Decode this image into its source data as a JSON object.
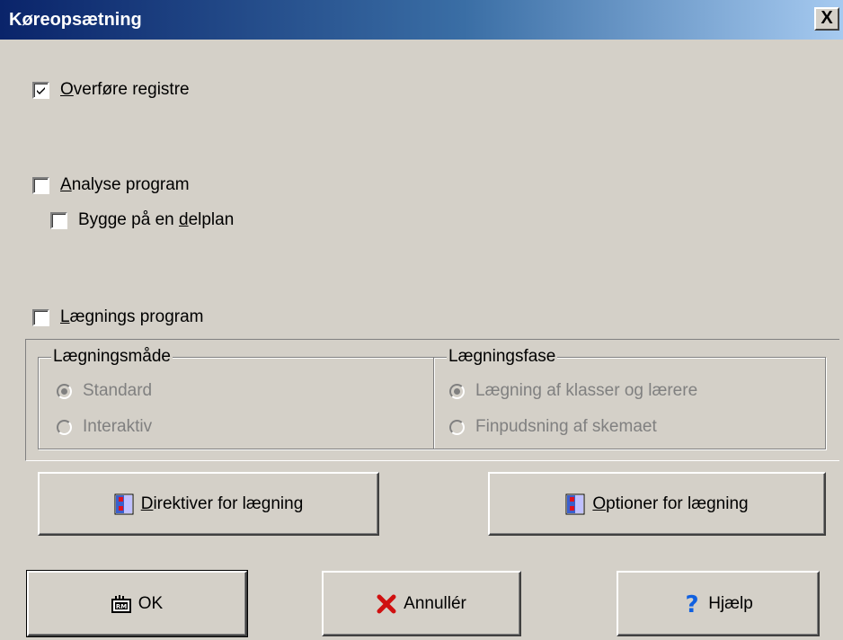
{
  "window": {
    "title": "Køreopsætning",
    "close_label": "X"
  },
  "checks": {
    "transfer": {
      "prefix": "",
      "accel": "O",
      "rest": "verføre registre",
      "checked": true
    },
    "analyse": {
      "prefix": "",
      "accel": "A",
      "rest": "nalyse program",
      "checked": false
    },
    "build": {
      "prefix": "Bygge på en ",
      "accel": "d",
      "rest": "elplan",
      "checked": false
    },
    "placement": {
      "prefix": "",
      "accel": "L",
      "rest": "ægnings program",
      "checked": false
    }
  },
  "mode_group": {
    "legend": "Lægningsmåde",
    "options": [
      {
        "label": "Standard",
        "selected": true
      },
      {
        "label": "Interaktiv",
        "selected": false
      }
    ]
  },
  "phase_group": {
    "legend": "Lægningsfase",
    "options": [
      {
        "label": "Lægning af klasser og lærere",
        "selected": true
      },
      {
        "label": "Finpudsning af skemaet",
        "selected": false
      }
    ]
  },
  "buttons": {
    "directives": {
      "accel": "D",
      "rest": "irektiver for lægning",
      "icon": "checklist-icon"
    },
    "options": {
      "accel": "O",
      "rest": "ptioner for lægning",
      "icon": "checklist-icon"
    },
    "ok": {
      "label": "OK",
      "icon": "ok-icon"
    },
    "cancel": {
      "label": "Annullér",
      "icon": "cross-icon"
    },
    "help": {
      "label": "Hjælp",
      "icon": "question-icon"
    }
  },
  "colors": {
    "face": "#d4d0c8",
    "title_start": "#0a246a",
    "title_end": "#a6caf0",
    "disabled": "#808080"
  }
}
